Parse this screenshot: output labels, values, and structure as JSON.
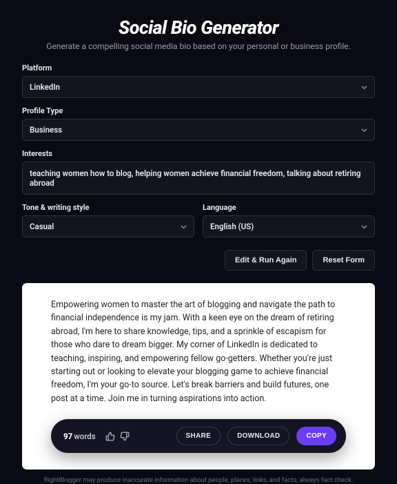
{
  "header": {
    "title": "Social Bio Generator",
    "subtitle": "Generate a compelling social media bio based on your personal or business profile."
  },
  "form": {
    "platform": {
      "label": "Platform",
      "value": "LinkedIn"
    },
    "profile_type": {
      "label": "Profile Type",
      "value": "Business"
    },
    "interests": {
      "label": "Interests",
      "value": "teaching women how to blog, helping women achieve financial freedom, talking about retiring abroad"
    },
    "tone": {
      "label": "Tone & writing style",
      "value": "Casual"
    },
    "language": {
      "label": "Language",
      "value": "English (US)"
    }
  },
  "actions": {
    "run": "Edit & Run Again",
    "reset": "Reset Form"
  },
  "result": {
    "bio": "Empowering women to master the art of blogging and navigate the path to financial independence is my jam. With a keen eye on the dream of retiring abroad, I'm here to share knowledge, tips, and a sprinkle of escapism for those who dare to dream bigger. My corner of LinkedIn is dedicated to teaching, inspiring, and empowering fellow go-getters. Whether you're just starting out or looking to elevate your blogging game to achieve financial freedom, I'm your go-to source. Let's break barriers and build futures, one post at a time. Join me in turning aspirations into action.",
    "word_count": "97",
    "word_label": "words",
    "share": "SHARE",
    "download": "DOWNLOAD",
    "copy": "COPY"
  },
  "footer": {
    "disclaimer": "RightBlogger may produce inaccurate information about people, places, links, and facts, always fact check."
  }
}
